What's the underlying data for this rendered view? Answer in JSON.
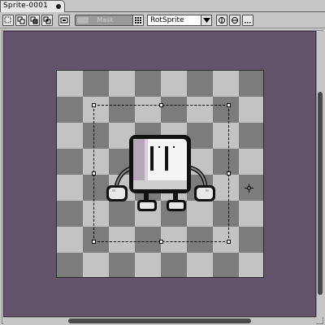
{
  "tab": {
    "title": "Sprite-0001"
  },
  "toolbar": {
    "mask_label": "Mask",
    "rotation_algorithm": "RotSprite"
  },
  "colors": {
    "viewport_background": "#62546b",
    "checker_light": "#c3c3c3",
    "checker_dark": "#7c7c7c"
  },
  "icons": {
    "buttons": [
      "select-rect-icon",
      "select-add-icon",
      "select-subtract-icon",
      "select-intersect-icon",
      "pivot-icon",
      "flip-horizontal-icon",
      "flip-vertical-icon",
      "more-icon"
    ]
  }
}
